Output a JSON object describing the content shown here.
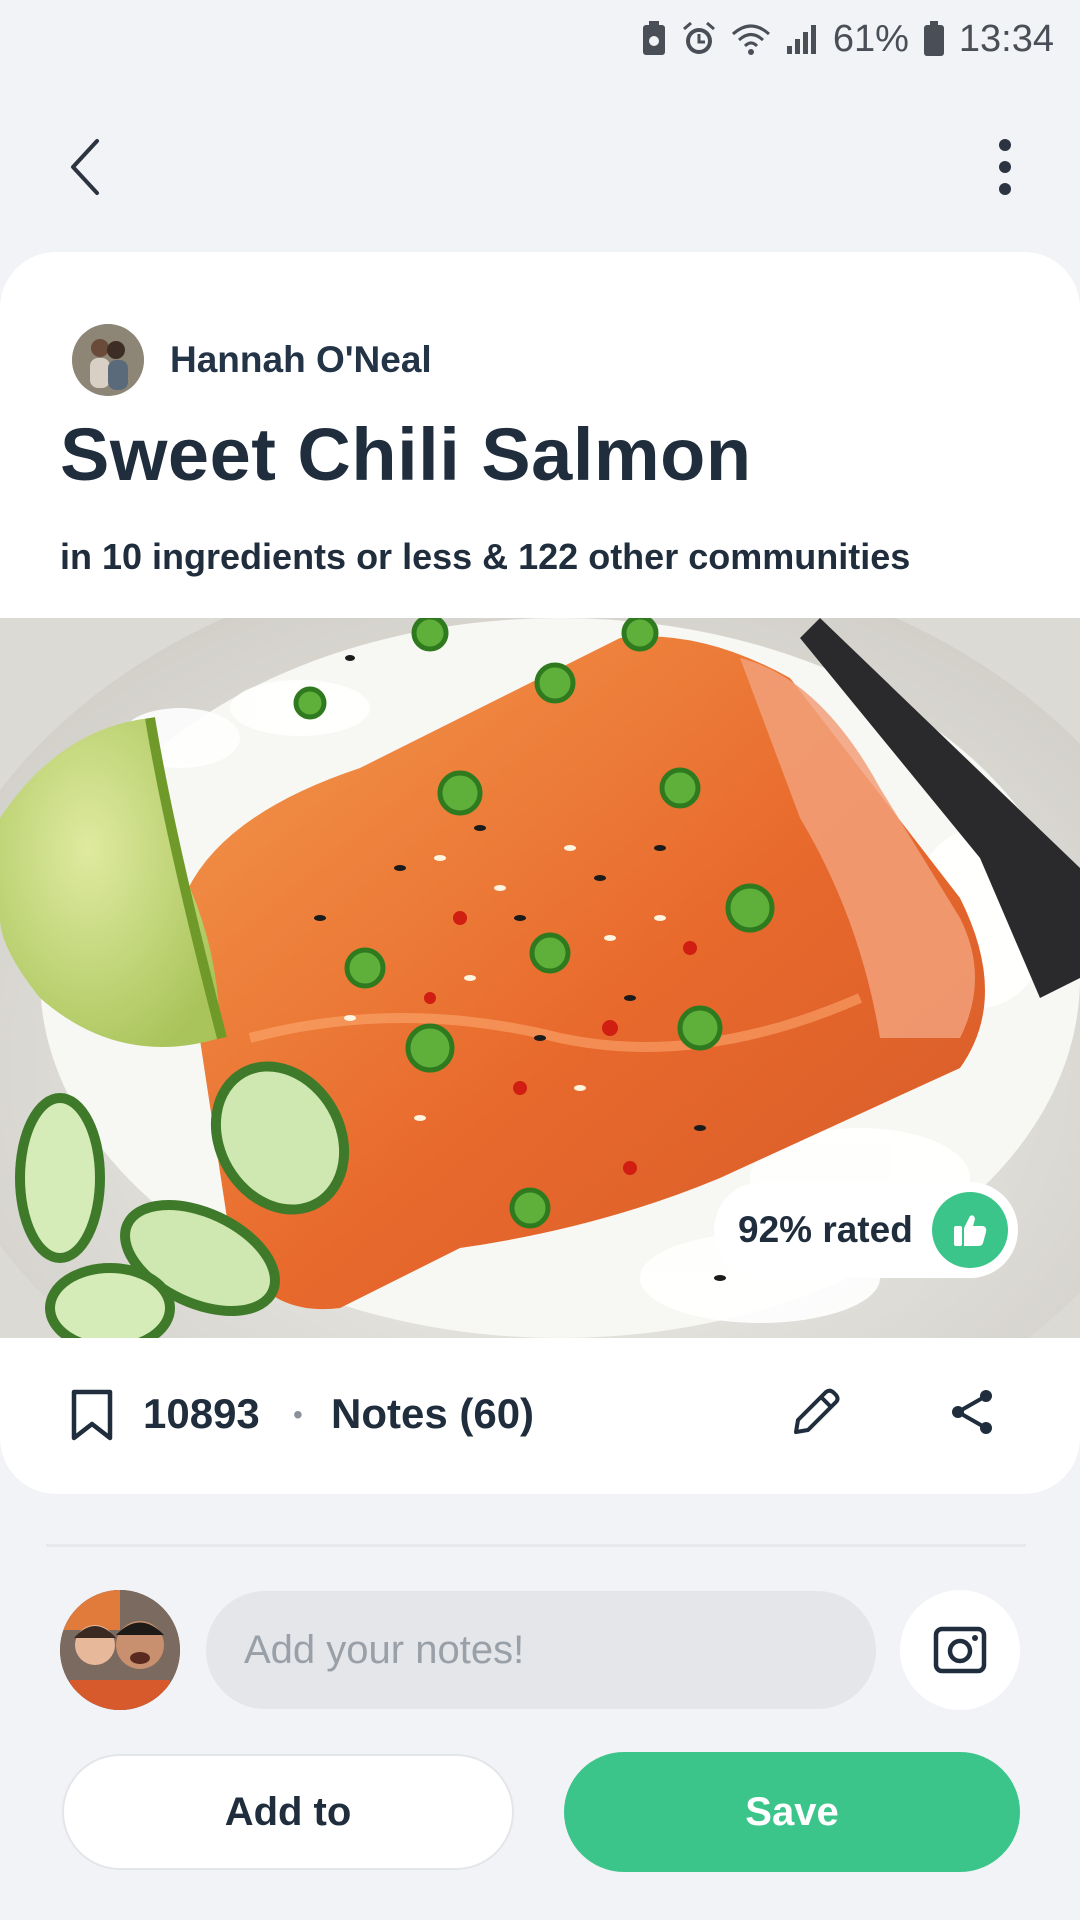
{
  "status_bar": {
    "battery_percent": "61%",
    "time": "13:34",
    "icons": [
      "battery-saver-icon",
      "alarm-icon",
      "wifi-icon",
      "signal-icon",
      "battery-icon"
    ]
  },
  "top_bar": {
    "back_icon": "chevron-left-icon",
    "menu_icon": "more-vertical-icon"
  },
  "recipe": {
    "author_name": "Hannah O'Neal",
    "title": "Sweet Chili Salmon",
    "subtitle": "in 10 ingredients or less & 122 other communities",
    "rating_label": "92% rated",
    "save_count": "10893",
    "separator": "•",
    "notes_label": "Notes (60)"
  },
  "notes": {
    "placeholder": "Add your notes!"
  },
  "buttons": {
    "add_to": "Add to",
    "save": "Save"
  },
  "colors": {
    "accent": "#3cc58b",
    "text": "#1f2d3d",
    "background": "#f2f3f6"
  }
}
